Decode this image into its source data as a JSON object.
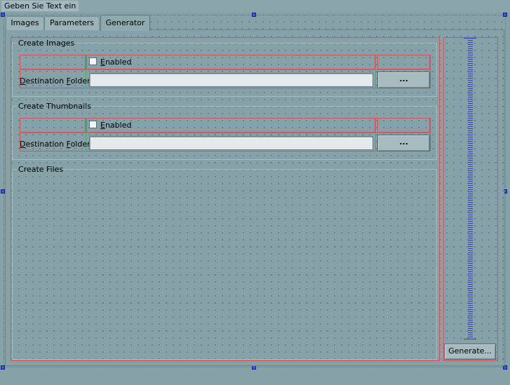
{
  "titlebar": {
    "text": "Geben Sie Text ein"
  },
  "tabs": [
    {
      "label": "Images",
      "active": false
    },
    {
      "label": "Parameters",
      "active": false
    },
    {
      "label": "Generator",
      "active": true
    }
  ],
  "groups": {
    "create_images": {
      "legend": "Create Images",
      "enabled_label": "Enabled",
      "enabled_checked": false,
      "destination_label": "Destination Folder:",
      "destination_value": "",
      "browse_label": "..."
    },
    "create_thumbnails": {
      "legend": "Create Thumbnails",
      "enabled_label": "Enabled",
      "enabled_checked": false,
      "destination_label": "Destination Folder:",
      "destination_value": "",
      "browse_label": "..."
    },
    "create_files": {
      "legend": "Create Files"
    }
  },
  "generate_button": {
    "label": "Generate..."
  },
  "colors": {
    "background": "#86a2a8",
    "layout_outline": "#d4535a",
    "grid_line": "#58a368",
    "spacer": "#3340c4",
    "selection_handle": "#3a5ad9"
  }
}
